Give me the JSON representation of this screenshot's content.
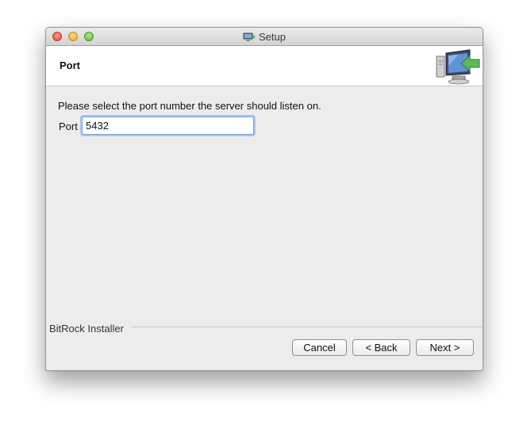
{
  "window": {
    "title": "Setup"
  },
  "header": {
    "title": "Port",
    "icon": "installer-computer-icon"
  },
  "content": {
    "instruction": "Please select the port number the server should listen on.",
    "port_label": "Port",
    "port_value": "5432"
  },
  "footer": {
    "brand": "BitRock Installer",
    "buttons": {
      "cancel": "Cancel",
      "back": "< Back",
      "next": "Next >"
    }
  },
  "colors": {
    "window_bg": "#ececec",
    "focus_ring": "#a8c6ee",
    "close": "#e0443a",
    "minimize": "#e6a526",
    "zoom": "#5cb83a"
  }
}
